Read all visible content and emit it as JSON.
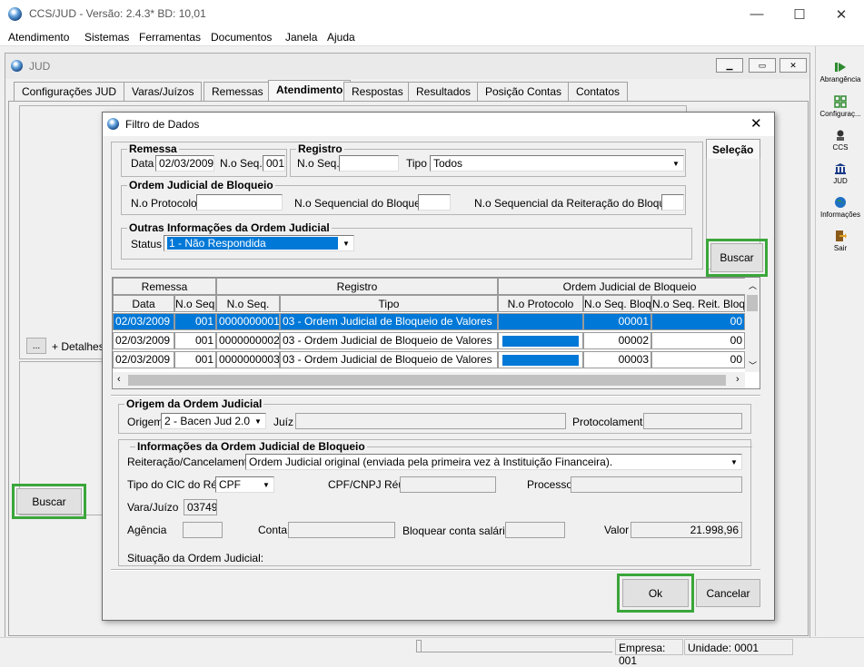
{
  "window": {
    "title": "CCS/JUD - Versão: 2.4.3* BD: 10,01",
    "minimize": "—",
    "maximize": "☐",
    "close": "✕"
  },
  "menu": [
    "Atendimento",
    "Sistemas",
    "Ferramentas",
    "Documentos",
    "Janela",
    "Ajuda"
  ],
  "toolbar": {
    "items": [
      {
        "label": "Abrangência",
        "icon": "play-icon"
      },
      {
        "label": "Configuraç...",
        "icon": "config-icon"
      },
      {
        "label": "CCS",
        "icon": "ccs-icon"
      },
      {
        "label": "JUD",
        "icon": "bank-icon"
      },
      {
        "label": "Informações",
        "icon": "globe-icon"
      },
      {
        "label": "Sair",
        "icon": "exit-icon"
      }
    ]
  },
  "child": {
    "title": "JUD",
    "tabs": [
      "Configurações JUD",
      "Varas/Juízos",
      "Remessas",
      "Atendimento",
      "Respostas",
      "Resultados",
      "Posição Contas",
      "Contatos"
    ],
    "active_tab": "Atendimento",
    "details_button": "...",
    "details_label": "+ Detalhes",
    "buscar": "Buscar"
  },
  "dialog": {
    "title": "Filtro de Dados",
    "close": "✕",
    "remessa": {
      "legend": "Remessa",
      "data_label": "Data",
      "data": "02/03/2009",
      "seq_label": "N.o Seq.",
      "seq": "001"
    },
    "registro": {
      "legend": "Registro",
      "seq_label": "N.o Seq.",
      "seq": "",
      "tipo_label": "Tipo",
      "tipo": "Todos"
    },
    "ordem": {
      "legend": "Ordem Judicial de Bloqueio",
      "protocolo_label": "N.o Protocolo",
      "seq_bloq_label": "N.o Sequencial do Bloqueio",
      "seq_reit_label": "N.o Sequencial da Reiteração do Bloqueio"
    },
    "outras": {
      "legend": "Outras Informações da Ordem Judicial",
      "status_label": "Status",
      "status": "1 - Não Respondida"
    },
    "selecao_tab": "Seleção",
    "buscar": "Buscar",
    "grid": {
      "group_headers": [
        "Remessa",
        "Registro",
        "Ordem Judicial de Bloqueio"
      ],
      "columns": [
        "Data",
        "N.o Seq.",
        "N.o Seq.",
        "Tipo",
        "N.o Protocolo",
        "N.o Seq. Bloq",
        "N.o Seq. Reit. Bloq."
      ],
      "rows": [
        [
          "02/03/2009",
          "001",
          "0000000001",
          "03 - Ordem Judicial de Bloqueio de Valores",
          "",
          "00001",
          "00"
        ],
        [
          "02/03/2009",
          "001",
          "0000000002",
          "03 - Ordem Judicial de Bloqueio de Valores",
          "",
          "00002",
          "00"
        ],
        [
          "02/03/2009",
          "001",
          "0000000003",
          "03 - Ordem Judicial de Bloqueio de Valores",
          "",
          "00003",
          "00"
        ]
      ]
    },
    "origem": {
      "legend": "Origem da Ordem Judicial",
      "origem_label": "Origem",
      "origem": "2 - Bacen Jud 2.0",
      "juiz_label": "Juíz",
      "protocolamento_label": "Protocolamento"
    },
    "info": {
      "legend": "Informações da Ordem Judicial de Bloqueio",
      "reiteracao_label": "Reiteração/Cancelamento",
      "reiteracao": "Ordem Judicial original (enviada pela primeira vez à Instituição Financeira).",
      "tipo_cic_label": "Tipo do CIC do Réu",
      "tipo_cic": "CPF",
      "cpf_label": "CPF/CNPJ Réu",
      "processo_label": "Processo",
      "vara_label": "Vara/Juízo",
      "vara": "03749",
      "agencia_label": "Agência",
      "conta_label": "Conta",
      "bloquear_label": "Bloquear conta salário",
      "valor_label": "Valor",
      "valor": "21.998,96",
      "situacao_label": "Situação da Ordem Judicial:"
    },
    "ok": "Ok",
    "cancelar": "Cancelar"
  },
  "status": {
    "empresa": "Empresa: 001",
    "unidade": "Unidade: 0001"
  },
  "colors": {
    "selection": "#0078d7",
    "highlight": "#3aa63a"
  }
}
